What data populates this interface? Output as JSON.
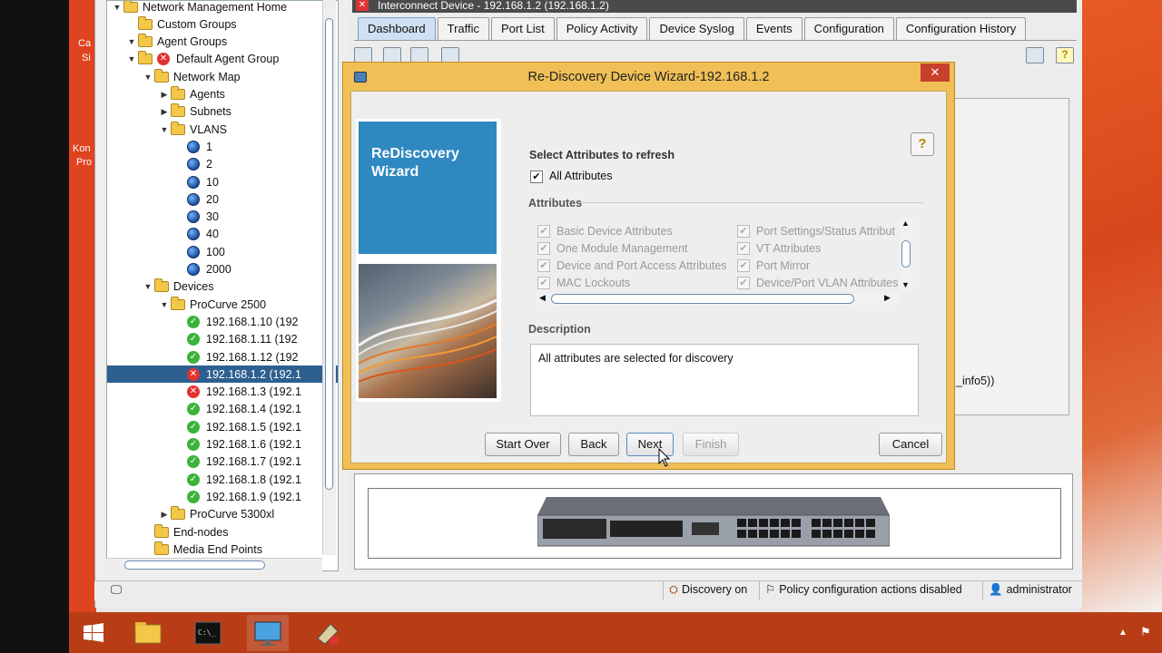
{
  "desktop": {
    "icon_labels": [
      "Ca",
      "Si",
      "Kon",
      "Pro"
    ]
  },
  "tree": {
    "items": [
      {
        "label": "Network Management Home",
        "indent": 0,
        "icon": "folder",
        "tw": "▼"
      },
      {
        "label": "Custom Groups",
        "indent": 1,
        "icon": "folder",
        "tw": ""
      },
      {
        "label": "Agent Groups",
        "indent": 1,
        "icon": "folder",
        "tw": "▼"
      },
      {
        "label": "Default Agent Group",
        "indent": 2,
        "icon": "folder-error",
        "tw": "▼"
      },
      {
        "label": "Network Map",
        "indent": 3,
        "icon": "folder",
        "tw": "▼"
      },
      {
        "label": "Agents",
        "indent": 4,
        "icon": "folder",
        "tw": "▶"
      },
      {
        "label": "Subnets",
        "indent": 4,
        "icon": "folder",
        "tw": "▶"
      },
      {
        "label": "VLANS",
        "indent": 4,
        "icon": "folder",
        "tw": "▼"
      },
      {
        "label": "1",
        "indent": 5,
        "icon": "globe",
        "tw": ""
      },
      {
        "label": "2",
        "indent": 5,
        "icon": "globe",
        "tw": ""
      },
      {
        "label": "10",
        "indent": 5,
        "icon": "globe",
        "tw": ""
      },
      {
        "label": "20",
        "indent": 5,
        "icon": "globe",
        "tw": ""
      },
      {
        "label": "30",
        "indent": 5,
        "icon": "globe",
        "tw": ""
      },
      {
        "label": "40",
        "indent": 5,
        "icon": "globe",
        "tw": ""
      },
      {
        "label": "100",
        "indent": 5,
        "icon": "globe",
        "tw": ""
      },
      {
        "label": "2000",
        "indent": 5,
        "icon": "globe",
        "tw": ""
      },
      {
        "label": "Devices",
        "indent": 3,
        "icon": "folder",
        "tw": "▼"
      },
      {
        "label": "ProCurve 2500",
        "indent": 4,
        "icon": "folder",
        "tw": "▼"
      },
      {
        "label": "192.168.1.10 (192",
        "indent": 5,
        "icon": "ok",
        "tw": ""
      },
      {
        "label": "192.168.1.11 (192",
        "indent": 5,
        "icon": "ok",
        "tw": ""
      },
      {
        "label": "192.168.1.12 (192",
        "indent": 5,
        "icon": "ok",
        "tw": ""
      },
      {
        "label": "192.168.1.2 (192.1",
        "indent": 5,
        "icon": "err",
        "tw": "",
        "selected": true
      },
      {
        "label": "192.168.1.3 (192.1",
        "indent": 5,
        "icon": "err",
        "tw": ""
      },
      {
        "label": "192.168.1.4 (192.1",
        "indent": 5,
        "icon": "ok",
        "tw": ""
      },
      {
        "label": "192.168.1.5 (192.1",
        "indent": 5,
        "icon": "ok",
        "tw": ""
      },
      {
        "label": "192.168.1.6 (192.1",
        "indent": 5,
        "icon": "ok",
        "tw": ""
      },
      {
        "label": "192.168.1.7 (192.1",
        "indent": 5,
        "icon": "ok",
        "tw": ""
      },
      {
        "label": "192.168.1.8 (192.1",
        "indent": 5,
        "icon": "ok",
        "tw": ""
      },
      {
        "label": "192.168.1.9 (192.1",
        "indent": 5,
        "icon": "ok",
        "tw": ""
      },
      {
        "label": "ProCurve 5300xl",
        "indent": 4,
        "icon": "folder",
        "tw": "▶"
      },
      {
        "label": "End-nodes",
        "indent": 3,
        "icon": "folder",
        "tw": ""
      },
      {
        "label": "Media End Points",
        "indent": 3,
        "icon": "folder",
        "tw": ""
      }
    ]
  },
  "window": {
    "title": "Interconnect Device - 192.168.1.2 (192.168.1.2)",
    "tabs": [
      "Dashboard",
      "Traffic",
      "Port List",
      "Policy Activity",
      "Device Syslog",
      "Events",
      "Configuration",
      "Configuration History"
    ],
    "active_tab": "Dashboard",
    "partial_text": "_info5))"
  },
  "dialog": {
    "title": "Re-Discovery Device Wizard-192.168.1.2",
    "close_glyph": "✕",
    "wizard_title_line1": "ReDiscovery",
    "wizard_title_line2": "Wizard",
    "help_glyph": "?",
    "select_label": "Select Attributes to refresh",
    "all_attributes_label": "All Attributes",
    "all_attributes_checked": true,
    "attributes_title": "Attributes",
    "attributes_left": [
      "Basic Device Attributes",
      "One Module Management",
      "Device and Port Access Attributes",
      "MAC Lockouts"
    ],
    "attributes_right": [
      "Port Settings/Status Attribut",
      "VT Attributes",
      "Port Mirror",
      "Device/Port VLAN Attributes"
    ],
    "description_title": "Description",
    "description_text": "All attributes are selected for discovery",
    "buttons": {
      "start_over": "Start Over",
      "back": "Back",
      "next": "Next",
      "finish": "Finish",
      "cancel": "Cancel"
    }
  },
  "status_bar": {
    "discovery": "Discovery on",
    "policy": "Policy configuration actions disabled",
    "user": "administrator"
  },
  "colors": {
    "dialog_frame": "#f0c057",
    "wizard_blue": "#2f88c0",
    "taskbar": "#b83d16",
    "selection": "#2d5f8f"
  }
}
